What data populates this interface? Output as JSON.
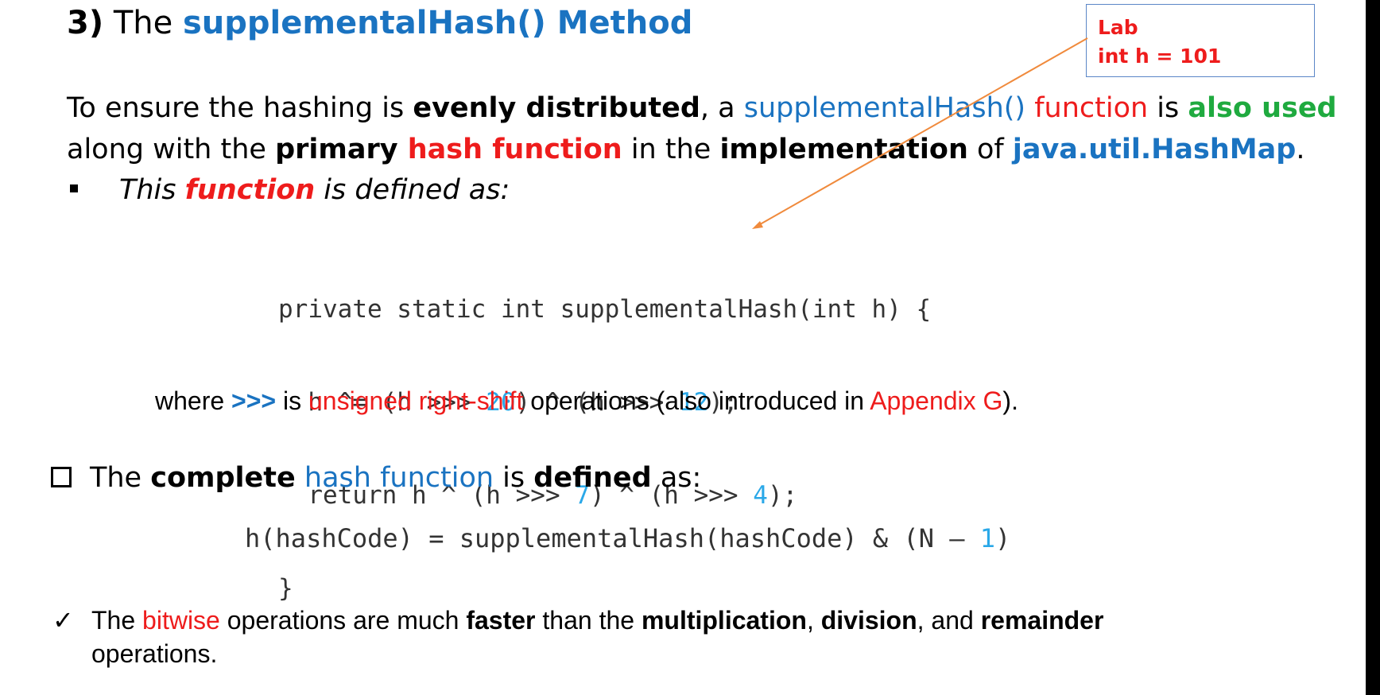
{
  "colors": {
    "blue": "#1a73c1",
    "red": "#ee1c1c",
    "green": "#1faa3f",
    "code_number": "#2aa8e8",
    "arrow": "#f08a3c",
    "lab_border": "#5b86c7"
  },
  "title": {
    "number": "3)",
    "prefix": "The",
    "name": "supplementalHash() Method"
  },
  "lab_note": {
    "line1": "Lab",
    "line2": "int h = 101"
  },
  "intro": {
    "p1_a": "To ensure the hashing is ",
    "p1_b": "evenly distributed",
    "p1_c": ", a ",
    "p1_d": "supplementalHash()",
    "p1_e": " function",
    "p1_f": " is ",
    "p1_g": "also used",
    "p2_a": "along with the ",
    "p2_b": "primary",
    "p2_c": " hash function",
    "p2_d": " in the ",
    "p2_e": "implementation",
    "p2_f": " of ",
    "p2_g": "java.util.HashMap",
    "p2_h": "."
  },
  "bullet": {
    "a": "This ",
    "b": "function",
    "c": " is defined as:"
  },
  "code": {
    "line1": "private static int supplementalHash(int h) {",
    "line2_a": "  h ^= (h >>> ",
    "line2_n1": "20",
    "line2_b": ") ^ (h >>> ",
    "line2_n2": "12",
    "line2_c": ");",
    "line3_a": "  return h ^ (h >>> ",
    "line3_n1": "7",
    "line3_b": ") ^ (h >>> ",
    "line3_n2": "4",
    "line3_c": ");",
    "line4": "}"
  },
  "where": {
    "a": "where ",
    "b": ">>>",
    "c": " is ",
    "d": "unsigned right-shift",
    "e": " operations (also introduced in ",
    "f": "Appendix G",
    "g": ")."
  },
  "complete": {
    "a": "The ",
    "b": "complete",
    "c": " hash function",
    "d": " is ",
    "e": "defined",
    "f": " as:"
  },
  "formula": {
    "a": "h(hashCode) = supplementalHash(hashCode) & (N – ",
    "n": "1",
    "b": ")"
  },
  "note": {
    "check": "✓",
    "a": "The ",
    "b": "bitwise",
    "c": " operations are much ",
    "d": "faster",
    "e": " than the ",
    "f": "multiplication",
    "g": ", ",
    "h": "division",
    "i": ", and ",
    "j": "remainder",
    "k": "operations."
  }
}
